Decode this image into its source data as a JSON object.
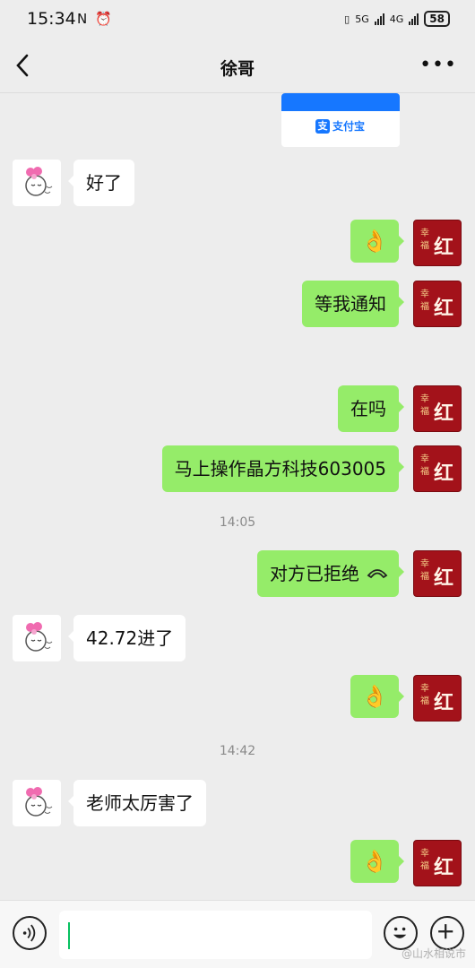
{
  "status_bar": {
    "time": "15:34",
    "icons": "N ⏰",
    "net1": "5G",
    "net2": "4G",
    "battery": "58"
  },
  "nav": {
    "title": "徐哥"
  },
  "card": {
    "label": "支付宝",
    "logo_glyph": "支"
  },
  "avatar_right": {
    "text1": "幸福",
    "text2": "红"
  },
  "messages": [
    {
      "side": "left",
      "text": "好了"
    },
    {
      "side": "right",
      "text": "👌"
    },
    {
      "side": "right",
      "text": "等我通知"
    },
    {
      "side": "right",
      "text": "在吗"
    },
    {
      "side": "right",
      "text": "马上操作晶方科技603005"
    },
    {
      "side": "time",
      "text": "14:05"
    },
    {
      "side": "right",
      "text": "对方已拒绝",
      "icon": "phone-hangup-icon"
    },
    {
      "side": "left",
      "text": "42.72进了"
    },
    {
      "side": "right",
      "text": "👌"
    },
    {
      "side": "time",
      "text": "14:42"
    },
    {
      "side": "left",
      "text": "老师太厉害了"
    },
    {
      "side": "right",
      "text": "👌"
    }
  ],
  "watermark": "@山水相说市"
}
